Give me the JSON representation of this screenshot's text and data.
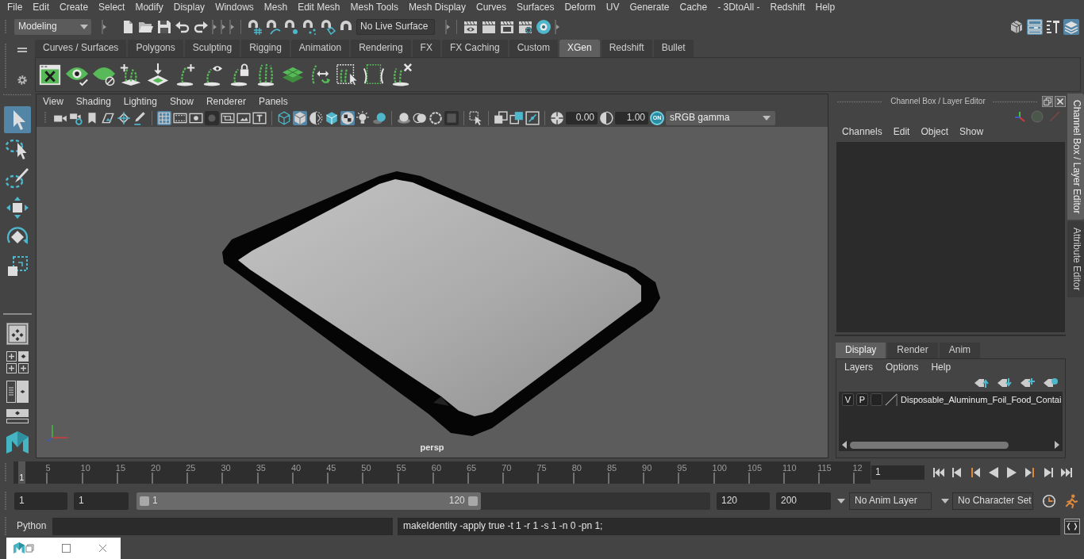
{
  "menu_bar": {
    "items": [
      "File",
      "Edit",
      "Create",
      "Select",
      "Modify",
      "Display",
      "Windows",
      "Mesh",
      "Edit Mesh",
      "Mesh Tools",
      "Mesh Display",
      "Curves",
      "Surfaces",
      "Deform",
      "UV",
      "Generate",
      "Cache",
      "- 3DtoAll -",
      "Redshift",
      "Help"
    ]
  },
  "status_line": {
    "workspace": "Modeling",
    "live_surface": "No Live Surface",
    "panel_buttons": [
      {
        "on": false
      },
      {
        "on": true
      },
      {
        "on": false
      },
      {
        "on": true
      }
    ]
  },
  "shelf": {
    "tabs": [
      {
        "label": "Curves / Surfaces",
        "selected": false
      },
      {
        "label": "Polygons",
        "selected": false
      },
      {
        "label": "Sculpting",
        "selected": false
      },
      {
        "label": "Rigging",
        "selected": false
      },
      {
        "label": "Animation",
        "selected": false
      },
      {
        "label": "Rendering",
        "selected": false
      },
      {
        "label": "FX",
        "selected": false
      },
      {
        "label": "FX Caching",
        "selected": false
      },
      {
        "label": "Custom",
        "selected": false
      },
      {
        "label": "XGen",
        "selected": true
      },
      {
        "label": "Redshift",
        "selected": false
      },
      {
        "label": "Bullet",
        "selected": false
      }
    ]
  },
  "toolbox": {
    "tools": [
      {
        "selected": true
      },
      {
        "selected": false
      },
      {
        "selected": false
      },
      {
        "selected": false
      },
      {
        "selected": false
      },
      {
        "selected": false
      }
    ]
  },
  "viewport": {
    "menus": [
      "View",
      "Shading",
      "Lighting",
      "Show",
      "Renderer",
      "Panels"
    ],
    "toolbar_buttons": [
      {
        "on": false
      },
      {
        "on": false
      },
      {
        "on": false
      },
      {
        "on": false
      },
      {
        "on": false
      },
      {
        "on": false
      },
      {
        "on": true
      },
      {
        "on": false
      },
      {
        "on": false
      },
      {
        "on": false
      },
      {
        "on": false
      },
      {
        "on": false
      },
      {
        "on": false
      },
      {
        "on": false
      },
      {
        "on": true
      },
      {
        "on": false
      },
      {
        "on": false
      },
      {
        "on": true
      },
      {
        "on": false
      },
      {
        "on": false
      },
      {
        "on": false
      },
      {
        "on": false
      },
      {
        "on": false
      },
      {
        "on": false
      },
      {
        "on": false
      },
      {
        "on": false
      },
      {
        "on": false
      },
      {
        "on": false
      },
      {
        "on": false
      },
      {
        "on": false
      }
    ],
    "exposure": "0.00",
    "gamma": "1.00",
    "color_management": {
      "label": "ON",
      "on": true
    },
    "view_transform": "sRGB gamma",
    "camera": "persp"
  },
  "channel_box": {
    "title": "Channel Box / Layer Editor",
    "menus": [
      "Channels",
      "Edit",
      "Object",
      "Show"
    ],
    "layer_tabs": [
      {
        "label": "Display",
        "selected": true
      },
      {
        "label": "Render",
        "selected": false
      },
      {
        "label": "Anim",
        "selected": false
      }
    ],
    "layer_menus": [
      "Layers",
      "Options",
      "Help"
    ],
    "layers": [
      {
        "visibility": "V",
        "playback": "P",
        "name": "Disposable_Aluminum_Foil_Food_Contai"
      }
    ]
  },
  "side_tabs": [
    {
      "label": "Channel Box / Layer Editor",
      "selected": true
    },
    {
      "label": "Attribute Editor",
      "selected": false
    }
  ],
  "timeline": {
    "tick_labels": [
      "5",
      "10",
      "15",
      "20",
      "25",
      "30",
      "35",
      "40",
      "45",
      "50",
      "55",
      "60",
      "65",
      "70",
      "75",
      "80",
      "85",
      "90",
      "95",
      "100",
      "105",
      "110",
      "115",
      "12"
    ],
    "current_frame": "1"
  },
  "playback": {
    "current_frame": "1"
  },
  "range_slider": {
    "animation_start": "1",
    "playback_start": "1",
    "range_start": "1",
    "range_end": "120",
    "level": 0.6,
    "playback_end": "120",
    "animation_end": "200",
    "anim_layer": "No Anim Layer",
    "character_set": "No Character Set"
  },
  "command_line": {
    "language": "Python",
    "result": "makeIdentity -apply true -t 1 -r 1 -s 1 -n 0 -pn 1;"
  }
}
